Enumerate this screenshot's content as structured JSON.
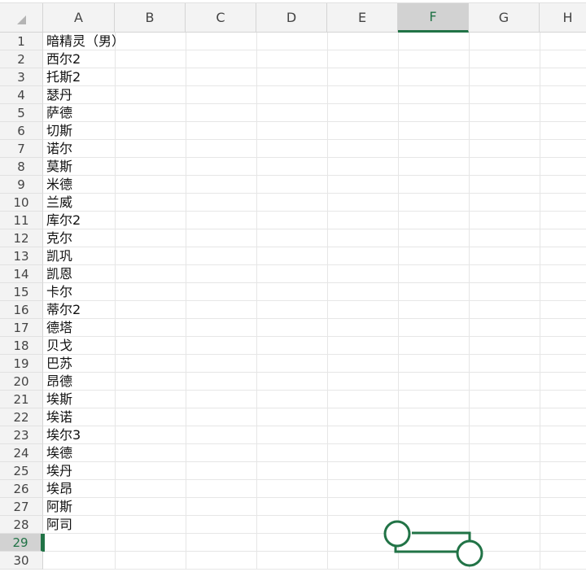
{
  "columns": [
    "A",
    "B",
    "C",
    "D",
    "E",
    "F",
    "G",
    "H"
  ],
  "active_column": "F",
  "active_row": "29",
  "rows": [
    {
      "num": "1",
      "a": "暗精灵（男）"
    },
    {
      "num": "2",
      "a": "西尔2"
    },
    {
      "num": "3",
      "a": "托斯2"
    },
    {
      "num": "4",
      "a": "瑟丹"
    },
    {
      "num": "5",
      "a": "萨德"
    },
    {
      "num": "6",
      "a": "切斯"
    },
    {
      "num": "7",
      "a": "诺尔"
    },
    {
      "num": "8",
      "a": "莫斯"
    },
    {
      "num": "9",
      "a": "米德"
    },
    {
      "num": "10",
      "a": "兰威"
    },
    {
      "num": "11",
      "a": "库尔2"
    },
    {
      "num": "12",
      "a": "克尔"
    },
    {
      "num": "13",
      "a": "凯巩"
    },
    {
      "num": "14",
      "a": "凯恩"
    },
    {
      "num": "15",
      "a": "卡尔"
    },
    {
      "num": "16",
      "a": "蒂尔2"
    },
    {
      "num": "17",
      "a": "德塔"
    },
    {
      "num": "18",
      "a": "贝戈"
    },
    {
      "num": "19",
      "a": "巴苏"
    },
    {
      "num": "20",
      "a": "昂德"
    },
    {
      "num": "21",
      "a": "埃斯"
    },
    {
      "num": "22",
      "a": "埃诺"
    },
    {
      "num": "23",
      "a": "埃尔3"
    },
    {
      "num": "24",
      "a": "埃德"
    },
    {
      "num": "25",
      "a": "埃丹"
    },
    {
      "num": "26",
      "a": "埃昂"
    },
    {
      "num": "27",
      "a": "阿斯"
    },
    {
      "num": "28",
      "a": "阿司"
    },
    {
      "num": "29",
      "a": ""
    },
    {
      "num": "30",
      "a": ""
    }
  ],
  "colors": {
    "accent": "#217346",
    "header_bg": "#f3f3f3",
    "header_active_bg": "#d2d2d2"
  },
  "icons": {
    "corner": "select-all-triangle",
    "shape": "connector-shape-with-handles"
  }
}
